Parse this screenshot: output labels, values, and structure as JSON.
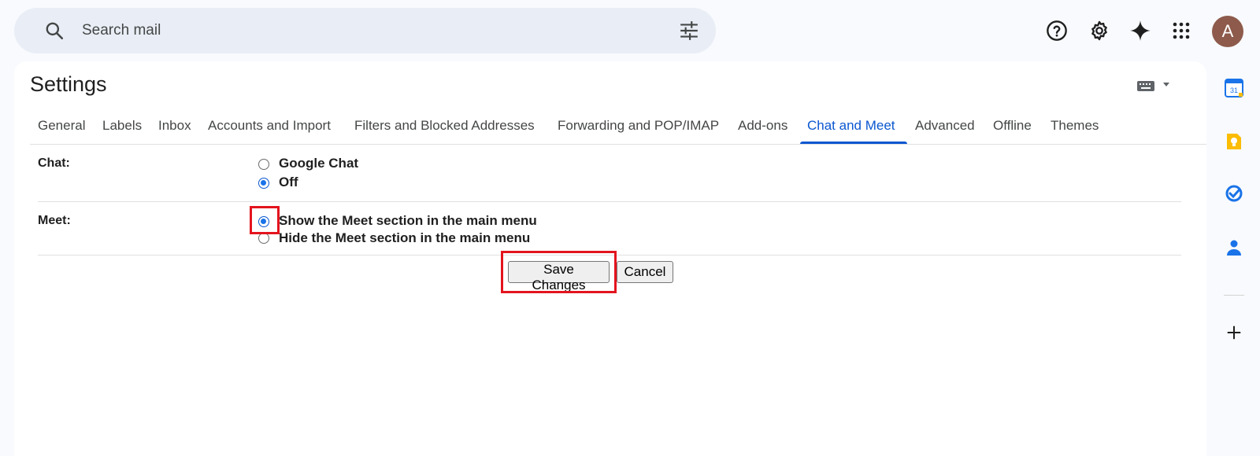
{
  "search": {
    "placeholder": "Search mail",
    "search_icon": "search-icon",
    "options_icon": "tune-icon"
  },
  "top_icons": [
    "help-icon",
    "gear-icon",
    "gemini-sparkle-icon",
    "apps-grid-icon"
  ],
  "account": {
    "avatar_letter": "A",
    "avatar_color": "#8d5a4b"
  },
  "settings": {
    "title": "Settings",
    "tabs": [
      {
        "label": "General",
        "active": false
      },
      {
        "label": "Labels",
        "active": false
      },
      {
        "label": "Inbox",
        "active": false
      },
      {
        "label": "Accounts and Import",
        "active": false
      },
      {
        "label": "Filters and Blocked Addresses",
        "active": false
      },
      {
        "label": "Forwarding and POP/IMAP",
        "active": false
      },
      {
        "label": "Add-ons",
        "active": false
      },
      {
        "label": "Chat and Meet",
        "active": true
      },
      {
        "label": "Advanced",
        "active": false
      },
      {
        "label": "Offline",
        "active": false
      },
      {
        "label": "Themes",
        "active": false
      }
    ],
    "chat": {
      "label": "Chat:",
      "options": [
        {
          "label": "Google Chat",
          "checked": false
        },
        {
          "label": "Off",
          "checked": true
        }
      ]
    },
    "meet": {
      "label": "Meet:",
      "options": [
        {
          "label": "Show the Meet section in the main menu",
          "checked": true
        },
        {
          "label": "Hide the Meet section in the main menu",
          "checked": false
        }
      ]
    },
    "save_label": "Save Changes",
    "cancel_label": "Cancel"
  },
  "side_panel": [
    "calendar-icon",
    "keep-icon",
    "tasks-icon",
    "contacts-icon",
    "plus-icon"
  ],
  "colors": {
    "accent": "#0b57d0",
    "highlight": "#e3141e",
    "background": "#f8fafd",
    "search_bg": "#e9eef6"
  }
}
